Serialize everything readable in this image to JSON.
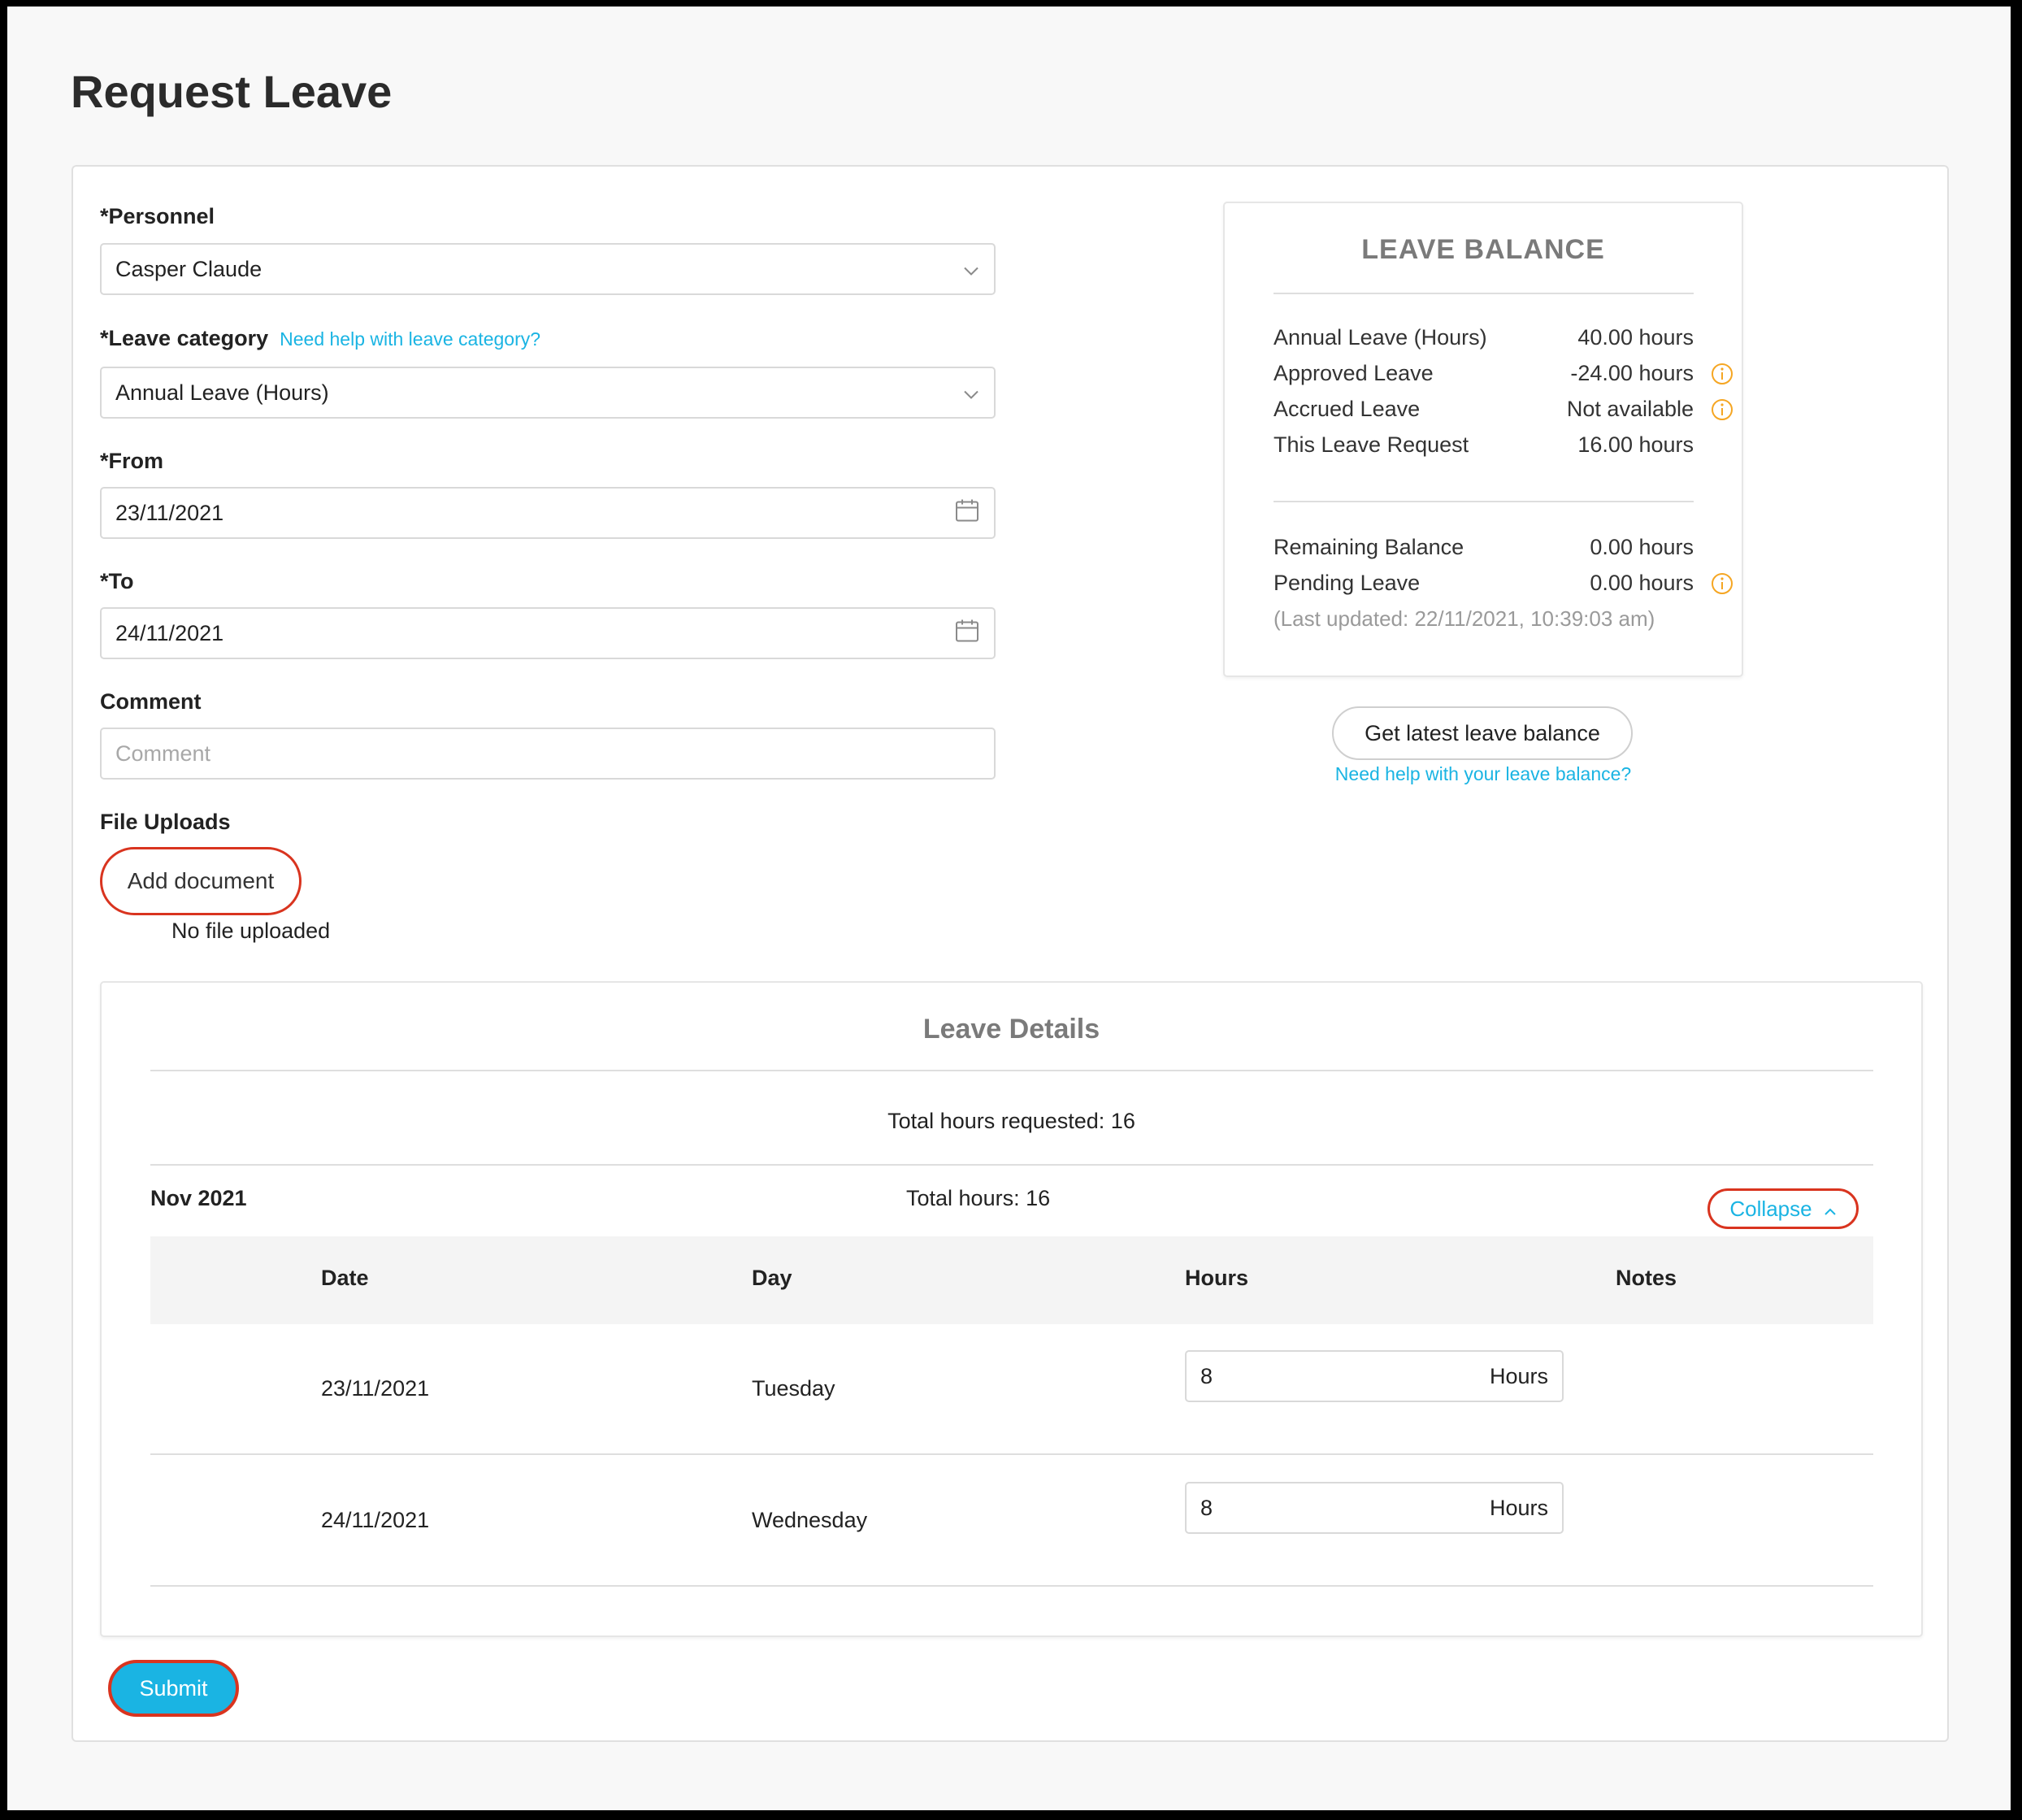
{
  "page": {
    "title": "Request Leave"
  },
  "form": {
    "personnel": {
      "label": "*Personnel",
      "value": "Casper Claude"
    },
    "leave_category": {
      "label": "*Leave category",
      "help_link": "Need help with leave category?",
      "value": "Annual Leave (Hours)"
    },
    "from": {
      "label": "*From",
      "value": "23/11/2021"
    },
    "to": {
      "label": "*To",
      "value": "24/11/2021"
    },
    "comment": {
      "label": "Comment",
      "placeholder": "Comment",
      "value": ""
    },
    "file_uploads": {
      "label": "File Uploads",
      "add_button": "Add document",
      "status": "No file uploaded"
    }
  },
  "leave_balance": {
    "title": "LEAVE BALANCE",
    "rows": [
      {
        "label": "Annual Leave (Hours)",
        "value": "40.00 hours"
      },
      {
        "label": "Approved Leave",
        "value": "-24.00 hours"
      },
      {
        "label": "Accrued Leave",
        "value": "Not available"
      },
      {
        "label": "This Leave Request",
        "value": "16.00 hours"
      },
      {
        "label": "Remaining Balance",
        "value": "0.00 hours"
      },
      {
        "label": "Pending Leave",
        "value": "0.00 hours"
      }
    ],
    "last_updated": "(Last updated: 22/11/2021, 10:39:03 am)",
    "refresh_button": "Get latest leave balance",
    "help_link": "Need help with your leave balance?"
  },
  "leave_details": {
    "title": "Leave Details",
    "total_requested": "Total hours requested: 16",
    "month": "Nov 2021",
    "month_total": "Total hours: 16",
    "collapse_label": "Collapse",
    "columns": [
      "Date",
      "Day",
      "Hours",
      "Notes"
    ],
    "rows": [
      {
        "date": "23/11/2021",
        "day": "Tuesday",
        "hours": "8",
        "unit": "Hours"
      },
      {
        "date": "24/11/2021",
        "day": "Wednesday",
        "hours": "8",
        "unit": "Hours"
      }
    ]
  },
  "actions": {
    "submit": "Submit"
  },
  "colors": {
    "accent": "#1ab4e3",
    "highlight": "#d9341f",
    "info_icon": "#f5a623"
  },
  "icons": [
    "chevron-down-icon",
    "calendar-icon",
    "info-icon",
    "chevron-up-icon"
  ]
}
